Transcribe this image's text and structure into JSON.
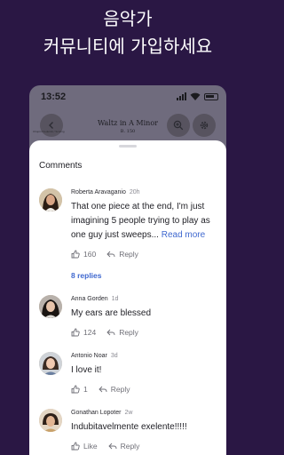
{
  "promo": {
    "line1": "음악가",
    "line2": "커뮤니티에 가입하세요"
  },
  "phone": {
    "status_time": "13:52",
    "song_title": "Waltz in A Minor",
    "song_subtitle": "B. 150",
    "credit_text": "Chopin Frederick / Scoring"
  },
  "sheet": {
    "title": "Comments"
  },
  "comments": [
    {
      "author": "Roberta Aravaganio",
      "ago": "20h",
      "text": "That one piece at the end, I'm just imagining 5 people trying to play as one guy just sweeps...",
      "more": "Read more",
      "likes": "160",
      "reply": "Reply",
      "replies": "8 replies"
    },
    {
      "author": "Anna Gorden",
      "ago": "1d",
      "text": "My ears are blessed",
      "likes": "124",
      "reply": "Reply"
    },
    {
      "author": "Antonio Noar",
      "ago": "3d",
      "text": "I love it!",
      "likes": "1",
      "reply": "Reply"
    },
    {
      "author": "Gonathan Lopoter",
      "ago": "2w",
      "text": "Indubitavelmente exelente!!!!!",
      "likes": "Like",
      "reply": "Reply"
    }
  ],
  "colors": {
    "background": "#2a1744",
    "link": "#3f68cf"
  }
}
